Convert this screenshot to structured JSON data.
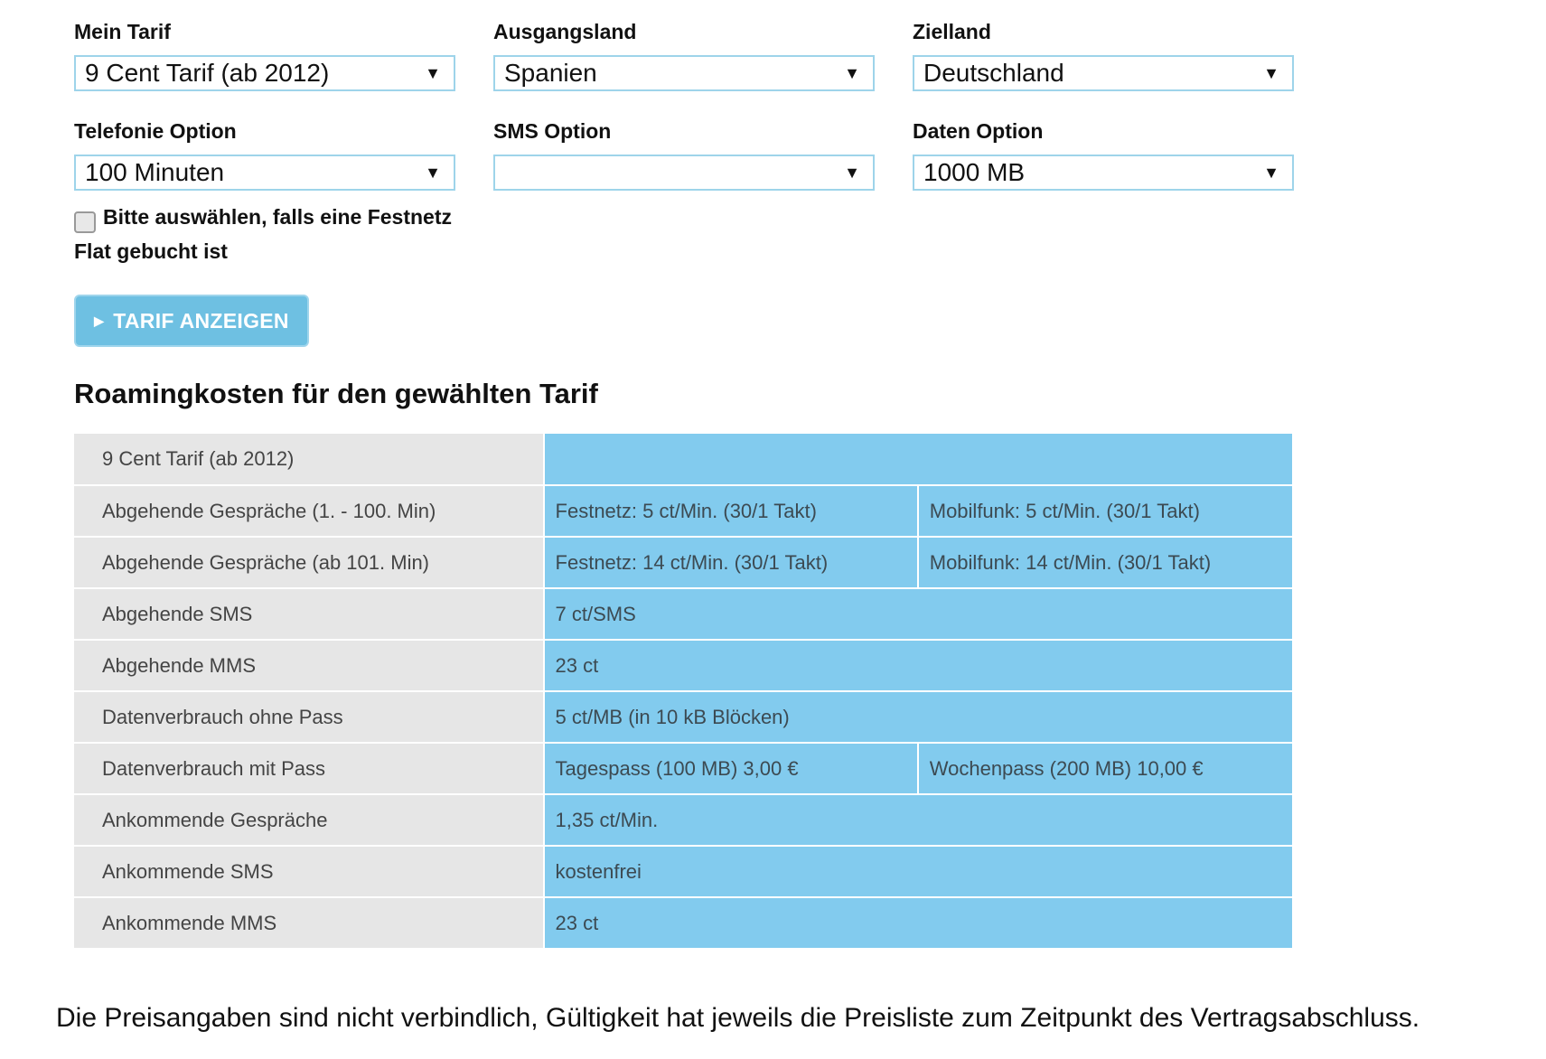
{
  "form": {
    "tarif": {
      "label": "Mein Tarif",
      "value": "9 Cent Tarif (ab 2012)"
    },
    "ausgangsland": {
      "label": "Ausgangsland",
      "value": "Spanien"
    },
    "zielland": {
      "label": "Zielland",
      "value": "Deutschland"
    },
    "telefonie": {
      "label": "Telefonie Option",
      "value": "100 Minuten"
    },
    "sms": {
      "label": "SMS Option",
      "value": ""
    },
    "daten": {
      "label": "Daten Option",
      "value": "1000 MB"
    },
    "festnetz_checkbox_label": "Bitte auswählen, falls eine Festnetz Flat gebucht ist",
    "festnetz_checked": false,
    "submit_label": "TARIF ANZEIGEN"
  },
  "heading": "Roamingkosten für den gewählten Tarif",
  "table": {
    "header": "9 Cent Tarif (ab 2012)",
    "rows": [
      {
        "label": "Abgehende Gespräche (1. - 100. Min)",
        "v1": "Festnetz: 5 ct/Min. (30/1 Takt)",
        "v2": "Mobilfunk: 5 ct/Min. (30/1 Takt)"
      },
      {
        "label": "Abgehende Gespräche (ab 101. Min)",
        "v1": "Festnetz: 14 ct/Min. (30/1 Takt)",
        "v2": "Mobilfunk: 14 ct/Min. (30/1 Takt)"
      },
      {
        "label": "Abgehende SMS",
        "v1": "7 ct/SMS"
      },
      {
        "label": "Abgehende MMS",
        "v1": "23 ct"
      },
      {
        "label": "Datenverbrauch ohne Pass",
        "v1": "5 ct/MB (in 10 kB Blöcken)"
      },
      {
        "label": "Datenverbrauch mit Pass",
        "v1": "Tagespass (100 MB) 3,00 €",
        "v2": "Wochenpass (200 MB) 10,00 €"
      },
      {
        "label": "Ankommende Gespräche",
        "v1": "1,35 ct/Min."
      },
      {
        "label": "Ankommende SMS",
        "v1": "kostenfrei"
      },
      {
        "label": "Ankommende MMS",
        "v1": "23 ct"
      }
    ]
  },
  "disclaimer": "Die Preisangaben sind nicht verbindlich, Gültigkeit hat jeweils die Preisliste zum Zeitpunkt des Vertragsabschluss.",
  "colors": {
    "accent": "#6ec0e2",
    "table_value_bg": "#82cbee",
    "table_label_bg": "#e6e6e6",
    "select_border": "#9ed4ea"
  }
}
